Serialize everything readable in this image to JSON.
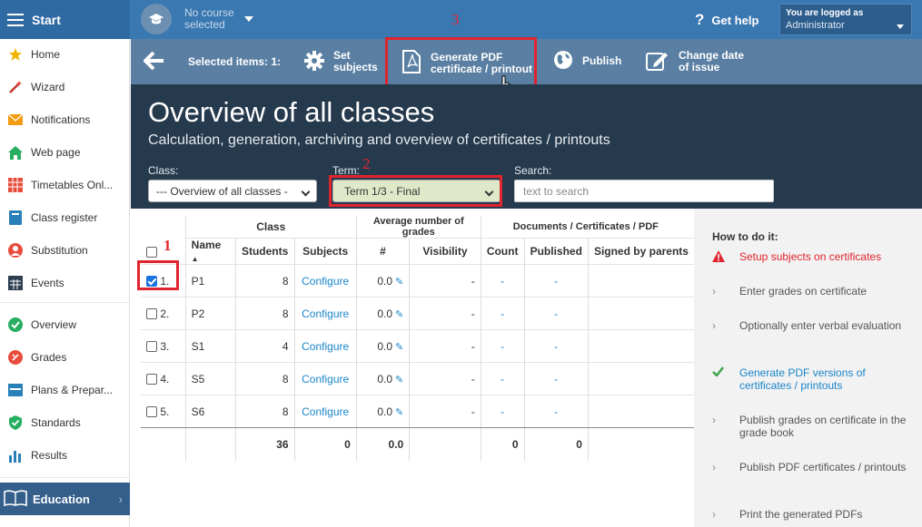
{
  "topbar": {
    "start_label": "Start",
    "course_text": "No course selected",
    "help_label": "Get help",
    "user_line1": "You are logged as",
    "user_line2": "Administrator"
  },
  "sidebar": {
    "items": [
      {
        "label": "Home",
        "icon": "star-icon",
        "color": "#f0b400"
      },
      {
        "label": "Wizard",
        "icon": "wand-icon",
        "color": "#e74c3c"
      },
      {
        "label": "Notifications",
        "icon": "envelope-icon",
        "color": "#f39c12"
      },
      {
        "label": "Web page",
        "icon": "home-icon",
        "color": "#27ae60"
      },
      {
        "label": "Timetables Onl...",
        "icon": "timetable-icon",
        "color": "#e74c3c"
      },
      {
        "label": "Class register",
        "icon": "book-icon",
        "color": "#2980b9"
      },
      {
        "label": "Substitution",
        "icon": "person-icon",
        "color": "#e74c3c"
      },
      {
        "label": "Events",
        "icon": "calendar-icon",
        "color": "#2c3e50"
      },
      {
        "label": "Overview",
        "icon": "check-circle-icon",
        "color": "#27ae60"
      },
      {
        "label": "Grades",
        "icon": "grades-icon",
        "color": "#e74c3c"
      },
      {
        "label": "Plans & Prepar...",
        "icon": "plans-icon",
        "color": "#2980b9"
      },
      {
        "label": "Standards",
        "icon": "shield-icon",
        "color": "#27ae60"
      },
      {
        "label": "Results",
        "icon": "bar-chart-icon",
        "color": "#2980b9"
      }
    ],
    "education_label": "Education"
  },
  "toolbar": {
    "selected_label": "Selected items: 1:",
    "set_subjects": "Set subjects",
    "generate_pdf_l1": "Generate PDF",
    "generate_pdf_l2": "certificate / printout",
    "publish": "Publish",
    "change_date_l1": "Change date",
    "change_date_l2": "of issue"
  },
  "header": {
    "title": "Overview of all classes",
    "subtitle": "Calculation, generation, archiving and overview of certificates / printouts",
    "class_label": "Class:",
    "class_value": "--- Overview of all classes -",
    "term_label": "Term:",
    "term_value": "Term 1/3 - Final",
    "search_label": "Search:",
    "search_placeholder": "text to search"
  },
  "annotations": {
    "n1": "1",
    "n2": "2",
    "n3": "3"
  },
  "table": {
    "group_class": "Class",
    "group_grades": "Average number of grades",
    "group_docs": "Documents / Certificates / PDF",
    "col_name": "Name",
    "col_students": "Students",
    "col_subjects": "Subjects",
    "col_hash": "#",
    "col_visibility": "Visibility",
    "col_count": "Count",
    "col_published": "Published",
    "col_signed": "Signed by parents",
    "rows": [
      {
        "idx": "1.",
        "checked": true,
        "name": "P1",
        "students": "8",
        "subjects": "Configure",
        "grades": "0.0",
        "visibility": "-",
        "count": "-",
        "published": "-"
      },
      {
        "idx": "2.",
        "checked": false,
        "name": "P2",
        "students": "8",
        "subjects": "Configure",
        "grades": "0.0",
        "visibility": "-",
        "count": "-",
        "published": "-"
      },
      {
        "idx": "3.",
        "checked": false,
        "name": "S1",
        "students": "4",
        "subjects": "Configure",
        "grades": "0.0",
        "visibility": "-",
        "count": "-",
        "published": "-"
      },
      {
        "idx": "4.",
        "checked": false,
        "name": "S5",
        "students": "8",
        "subjects": "Configure",
        "grades": "0.0",
        "visibility": "-",
        "count": "-",
        "published": "-"
      },
      {
        "idx": "5.",
        "checked": false,
        "name": "S6",
        "students": "8",
        "subjects": "Configure",
        "grades": "0.0",
        "visibility": "-",
        "count": "-",
        "published": "-"
      }
    ],
    "totals": {
      "students": "36",
      "subjects": "0",
      "grades": "0.0",
      "count": "0",
      "published": "0"
    }
  },
  "howto": {
    "title": "How to do it:",
    "steps": [
      {
        "text": "Setup subjects on certificates",
        "state": "warning"
      },
      {
        "text": "Enter grades on certificate",
        "state": "todo"
      },
      {
        "text": "Optionally enter verbal evaluation",
        "state": "todo"
      },
      {
        "text": "Generate PDF versions of certificates / printouts",
        "state": "done"
      },
      {
        "text": "Publish grades on certificate in the grade book",
        "state": "todo"
      },
      {
        "text": "Publish PDF certificates / printouts",
        "state": "todo"
      },
      {
        "text": "Print the generated PDFs",
        "state": "todo"
      }
    ]
  },
  "colors": {
    "topbar": "#3a78b1",
    "toolbar": "#5a7fa3",
    "header": "#263a4d",
    "highlight": "#e0242e",
    "link": "#1a85c9"
  }
}
